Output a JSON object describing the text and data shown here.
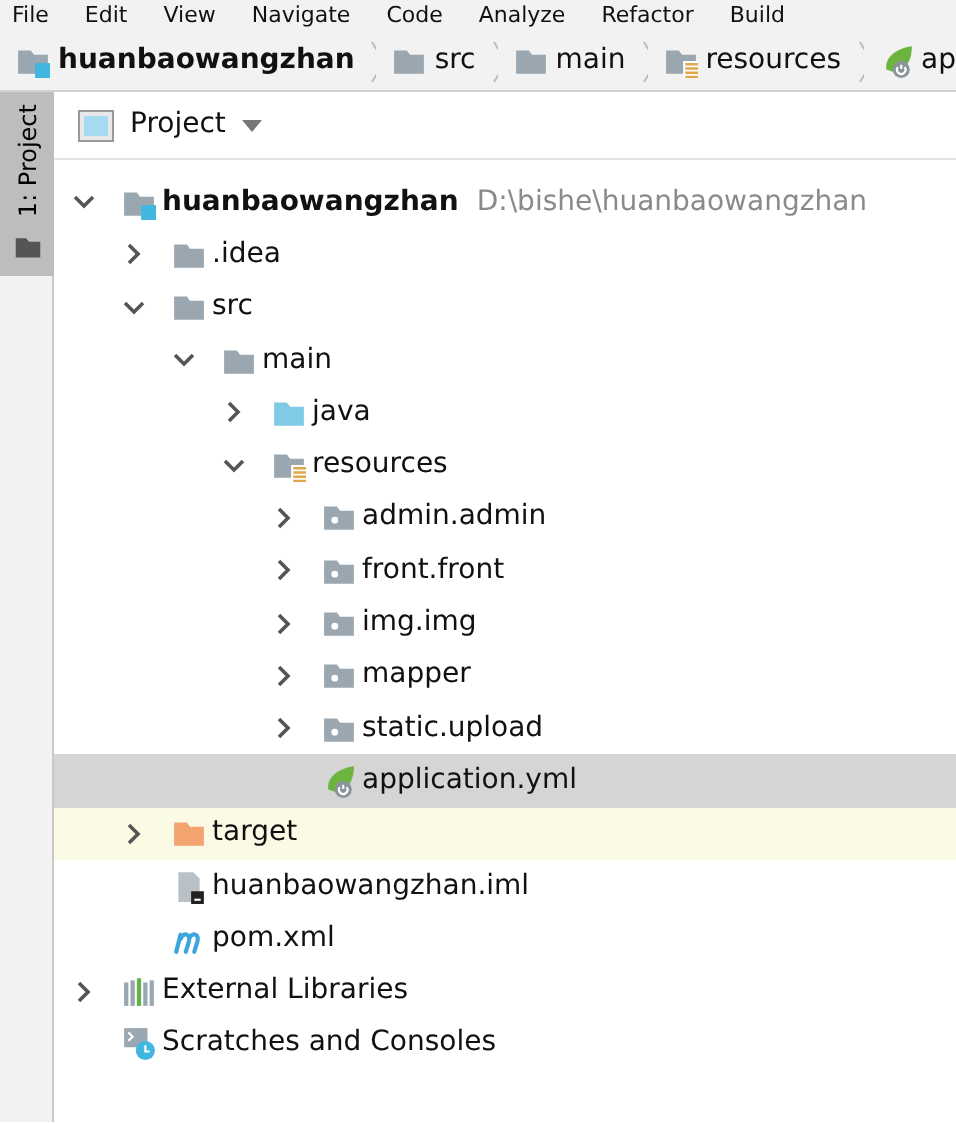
{
  "menu_bar": [
    "File",
    "Edit",
    "View",
    "Navigate",
    "Code",
    "Analyze",
    "Refactor",
    "Build"
  ],
  "breadcrumbs": [
    {
      "label": "huanbaowangzhan",
      "kind": "module"
    },
    {
      "label": "src",
      "kind": "folder"
    },
    {
      "label": "main",
      "kind": "folder"
    },
    {
      "label": "resources",
      "kind": "resources-folder"
    },
    {
      "label": "ap",
      "kind": "spring-file"
    }
  ],
  "tool_strip": {
    "label": "1: Project",
    "selected": true
  },
  "panel": {
    "title": "Project"
  },
  "tree": [
    {
      "label": "huanbaowangzhan",
      "path": "D:\\bishe\\huanbaowangzhan",
      "kind": "module",
      "expanded": true,
      "selected": false,
      "children": [
        {
          "label": ".idea",
          "kind": "folder",
          "expanded": false,
          "selected": false
        },
        {
          "label": "src",
          "kind": "folder",
          "expanded": true,
          "selected": false,
          "children": [
            {
              "label": "main",
              "kind": "folder",
              "expanded": true,
              "selected": false,
              "children": [
                {
                  "label": "java",
                  "kind": "source-folder",
                  "expanded": false,
                  "selected": false
                },
                {
                  "label": "resources",
                  "kind": "resources-folder",
                  "expanded": true,
                  "selected": false,
                  "children": [
                    {
                      "label": "admin.admin",
                      "kind": "package-folder",
                      "expanded": false,
                      "selected": false
                    },
                    {
                      "label": "front.front",
                      "kind": "package-folder",
                      "expanded": false,
                      "selected": false
                    },
                    {
                      "label": "img.img",
                      "kind": "package-folder",
                      "expanded": false,
                      "selected": false
                    },
                    {
                      "label": "mapper",
                      "kind": "package-folder",
                      "expanded": false,
                      "selected": false
                    },
                    {
                      "label": "static.upload",
                      "kind": "package-folder",
                      "expanded": false,
                      "selected": false
                    },
                    {
                      "label": "application.yml",
                      "kind": "spring-file",
                      "selected": true
                    }
                  ]
                }
              ]
            }
          ]
        },
        {
          "label": "target",
          "kind": "excluded-folder",
          "expanded": false,
          "selected": false
        },
        {
          "label": "huanbaowangzhan.iml",
          "kind": "iml-file",
          "selected": false
        },
        {
          "label": "pom.xml",
          "kind": "maven-file",
          "selected": false
        }
      ]
    },
    {
      "label": "External Libraries",
      "kind": "libraries",
      "expanded": false,
      "selected": false
    },
    {
      "label": "Scratches and Consoles",
      "kind": "scratches",
      "selected": false
    }
  ]
}
